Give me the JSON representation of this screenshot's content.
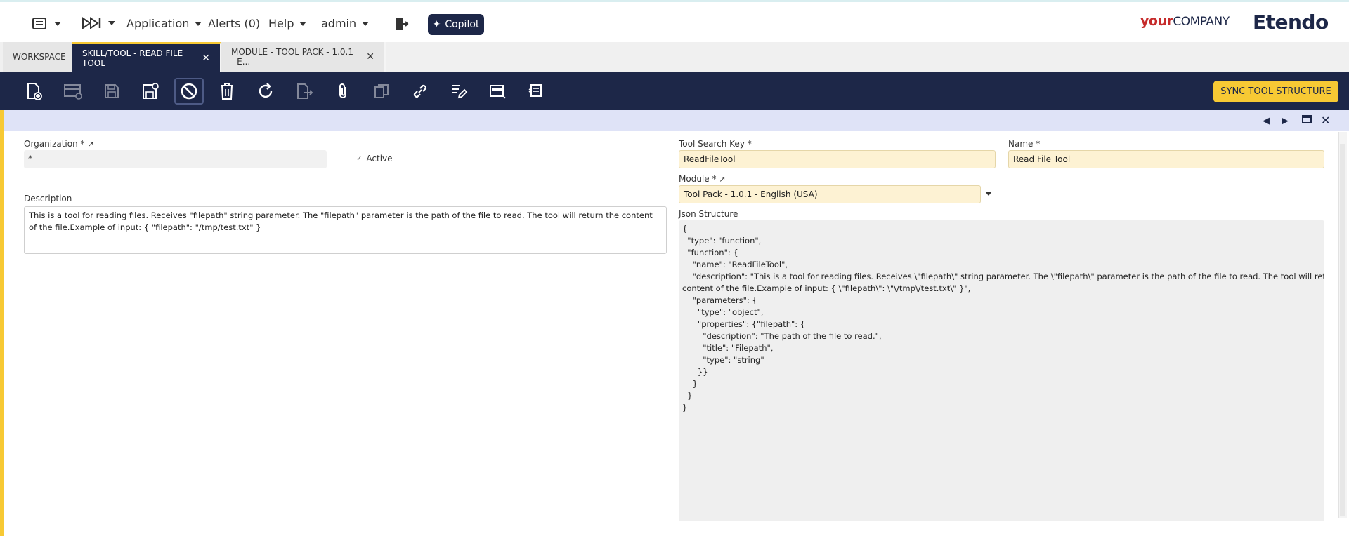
{
  "topbar": {
    "application_label": "Application",
    "alerts_label": "Alerts (0)",
    "help_label": "Help",
    "user_label": "admin",
    "copilot_label": "Copilot",
    "logo_your": "your",
    "logo_company": "COMPANY",
    "logo_brand": "Etendo"
  },
  "tabs": [
    {
      "label": "WORKSPACE"
    },
    {
      "label": "SKILL/TOOL - READ FILE TOOL"
    },
    {
      "label": "MODULE - TOOL PACK - 1.0.1 - E..."
    }
  ],
  "toolbar": {
    "sync_label": "SYNC TOOL STRUCTURE"
  },
  "form": {
    "organization_label": "Organization *",
    "organization_value": "*",
    "active_label": "Active",
    "description_label": "Description",
    "description_value": "This is a tool for reading files. Receives \"filepath\" string parameter. The \"filepath\" parameter is the path of the file to read. The tool will return the content of the file.Example of input: { \"filepath\": \"/tmp/test.txt\" }",
    "search_key_label": "Tool Search Key *",
    "search_key_value": "ReadFileTool",
    "name_label": "Name *",
    "name_value": "Read File Tool",
    "module_label": "Module *",
    "module_value": "Tool Pack - 1.0.1 - English (USA)",
    "json_label": "Json Structure",
    "json_value": "{\n  \"type\": \"function\",\n  \"function\": {\n    \"name\": \"ReadFileTool\",\n    \"description\": \"This is a tool for reading files. Receives \\\"filepath\\\" string parameter. The \\\"filepath\\\" parameter is the path of the file to read. The tool will return the\ncontent of the file.Example of input: { \\\"filepath\\\": \\\"\\/tmp\\/test.txt\\\" }\",\n    \"parameters\": {\n      \"type\": \"object\",\n      \"properties\": {\"filepath\": {\n        \"description\": \"The path of the file to read.\",\n        \"title\": \"Filepath\",\n        \"type\": \"string\"\n      }}\n    }\n  }\n}"
  },
  "colors": {
    "navy": "#1d2748",
    "accent_yellow": "#f7c934",
    "required_field": "#fdf2d3"
  }
}
